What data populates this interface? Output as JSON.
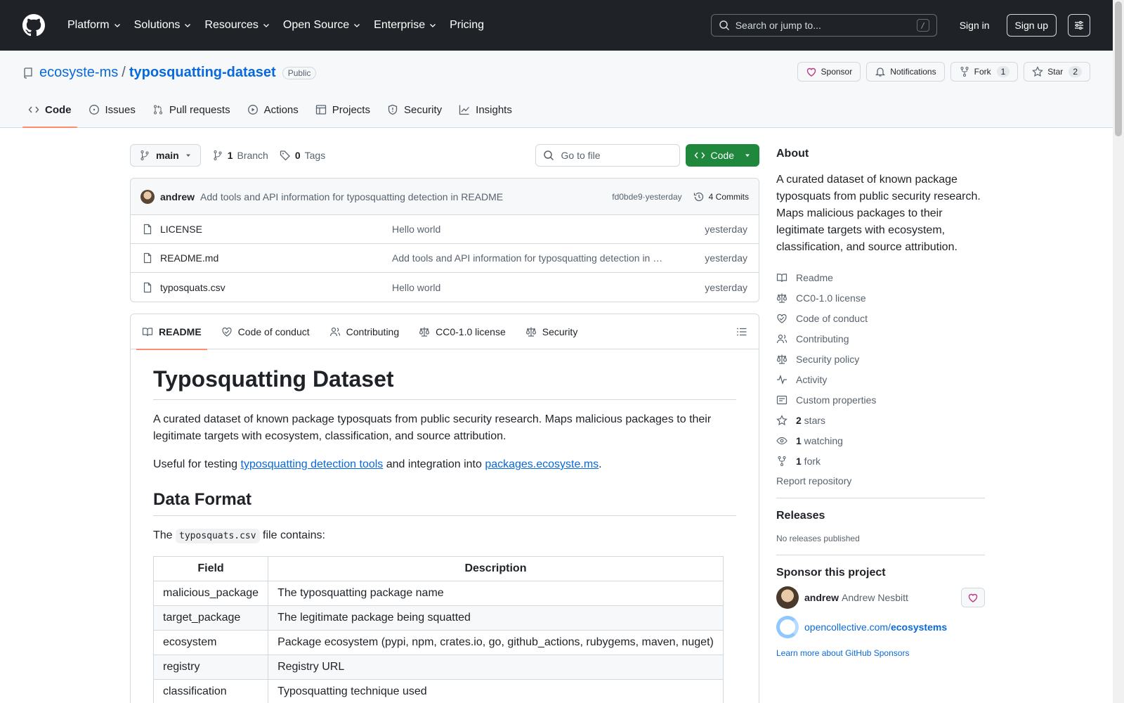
{
  "header": {
    "nav": [
      {
        "label": "Platform",
        "dropdown": true
      },
      {
        "label": "Solutions",
        "dropdown": true
      },
      {
        "label": "Resources",
        "dropdown": true
      },
      {
        "label": "Open Source",
        "dropdown": true
      },
      {
        "label": "Enterprise",
        "dropdown": true
      },
      {
        "label": "Pricing",
        "dropdown": false
      }
    ],
    "search_placeholder": "Search or jump to...",
    "search_key": "/",
    "sign_in": "Sign in",
    "sign_up": "Sign up"
  },
  "repo": {
    "owner": "ecosyste-ms",
    "separator": "/",
    "name": "typosquatting-dataset",
    "visibility": "Public",
    "sponsor_label": "Sponsor",
    "notifications_label": "Notifications",
    "fork_label": "Fork",
    "fork_count": "1",
    "star_label": "Star",
    "star_count": "2",
    "tabs": [
      {
        "label": "Code",
        "icon": "code-icon",
        "active": true
      },
      {
        "label": "Issues",
        "icon": "issue-icon",
        "active": false
      },
      {
        "label": "Pull requests",
        "icon": "pull-request-icon",
        "active": false
      },
      {
        "label": "Actions",
        "icon": "play-icon",
        "active": false
      },
      {
        "label": "Projects",
        "icon": "table-icon",
        "active": false
      },
      {
        "label": "Security",
        "icon": "shield-icon",
        "active": false
      },
      {
        "label": "Insights",
        "icon": "graph-icon",
        "active": false
      }
    ]
  },
  "toolbar": {
    "branch": "main",
    "branch_count": "1",
    "branch_label": "Branch",
    "tag_count": "0",
    "tag_label": "Tags",
    "goto_placeholder": "Go to file",
    "code_button": "Code"
  },
  "commit": {
    "author": "andrew",
    "message": "Add tools and API information for typosquatting detection in README",
    "sha": "fd0bde9",
    "dot": " · ",
    "time": "yesterday",
    "commits_label": "4 Commits"
  },
  "files": [
    {
      "name": "LICENSE",
      "message": "Hello world",
      "time": "yesterday"
    },
    {
      "name": "README.md",
      "message": "Add tools and API information for typosquatting detection in README",
      "time": "yesterday"
    },
    {
      "name": "typosquats.csv",
      "message": "Hello world",
      "time": "yesterday"
    }
  ],
  "readme_tabs": [
    {
      "label": "README",
      "icon": "book-icon",
      "active": true
    },
    {
      "label": "Code of conduct",
      "icon": "code-of-conduct-icon",
      "active": false
    },
    {
      "label": "Contributing",
      "icon": "people-icon",
      "active": false
    },
    {
      "label": "CC0-1.0 license",
      "icon": "law-icon",
      "active": false
    },
    {
      "label": "Security",
      "icon": "law-icon",
      "active": false
    }
  ],
  "readme": {
    "title": "Typosquatting Dataset",
    "intro": "A curated dataset of known package typosquats from public security research. Maps malicious packages to their legitimate targets with ecosystem, classification, and source attribution.",
    "useful_prefix": "Useful for testing ",
    "useful_link1": "typosquatting detection tools",
    "useful_mid": " and integration into ",
    "useful_link2": "packages.ecosyste.ms",
    "useful_suffix": ".",
    "data_format_heading": "Data Format",
    "file_prefix": "The ",
    "file_code": "typosquats.csv",
    "file_suffix": " file contains:",
    "table_headers": [
      "Field",
      "Description"
    ],
    "table_rows": [
      [
        "malicious_package",
        "The typosquatting package name"
      ],
      [
        "target_package",
        "The legitimate package being squatted"
      ],
      [
        "ecosystem",
        "Package ecosystem (pypi, npm, crates.io, go, github_actions, rubygems, maven, nuget)"
      ],
      [
        "registry",
        "Registry URL"
      ],
      [
        "classification",
        "Typosquatting technique used"
      ]
    ]
  },
  "about": {
    "heading": "About",
    "description": "A curated dataset of known package typosquats from public security research. Maps malicious packages to their legitimate targets with ecosystem, classification, and source attribution.",
    "links": [
      {
        "label": "Readme",
        "icon": "book-icon",
        "bold": ""
      },
      {
        "label": "CC0-1.0 license",
        "icon": "law-icon",
        "bold": ""
      },
      {
        "label": "Code of conduct",
        "icon": "code-of-conduct-icon",
        "bold": ""
      },
      {
        "label": "Contributing",
        "icon": "people-icon",
        "bold": ""
      },
      {
        "label": "Security policy",
        "icon": "law-icon",
        "bold": ""
      },
      {
        "label": "Activity",
        "icon": "pulse-icon",
        "bold": ""
      },
      {
        "label": "Custom properties",
        "icon": "note-icon",
        "bold": ""
      },
      {
        "label": " stars",
        "icon": "star-icon",
        "bold": "2"
      },
      {
        "label": " watching",
        "icon": "eye-icon",
        "bold": "1"
      },
      {
        "label": " fork",
        "icon": "fork-icon",
        "bold": "1"
      }
    ],
    "report": "Report repository"
  },
  "releases": {
    "heading": "Releases",
    "empty": "No releases published"
  },
  "sponsor": {
    "heading": "Sponsor this project",
    "login": "andrew",
    "fullname": "Andrew Nesbitt",
    "oc_prefix": "opencollective.com/",
    "oc_bold": "ecosystems",
    "learn_more": "Learn more about GitHub Sponsors"
  },
  "colors": {
    "header_bg": "#1f2328",
    "link": "#0969da",
    "code_button": "#1f883d",
    "active_tab_underline": "#fd8c73",
    "sponsor_heart": "#bf3989"
  }
}
